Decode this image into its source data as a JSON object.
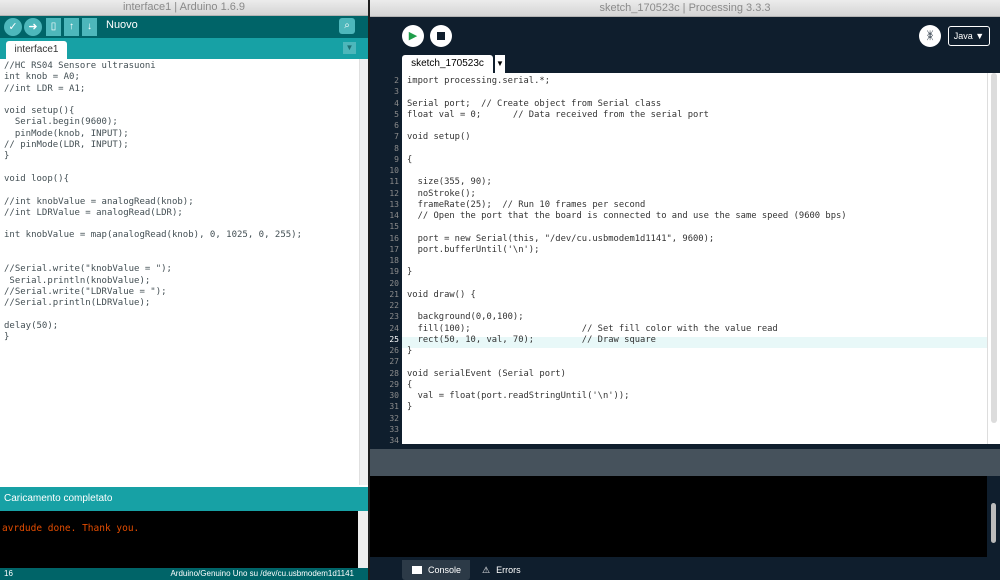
{
  "arduino": {
    "title": "interface1 | Arduino 1.6.9",
    "new_label": "Nuovo",
    "tab_label": "interface1",
    "code_lines": [
      "//HC RS04 Sensore ultrasuoni",
      "int knob = A0;",
      "//int LDR = A1;",
      "",
      "void setup(){",
      "  Serial.begin(9600);",
      "  pinMode(knob, INPUT);",
      "// pinMode(LDR, INPUT);",
      "}",
      "",
      "void loop(){",
      "",
      "//int knobValue = analogRead(knob);",
      "//int LDRValue = analogRead(LDR);",
      "",
      "int knobValue = map(analogRead(knob), 0, 1025, 0, 255);",
      "",
      "",
      "//Serial.write(\"knobValue = \");",
      " Serial.println(knobValue);",
      "//Serial.write(\"LDRValue = \");",
      "//Serial.println(LDRValue);",
      "",
      "delay(50);",
      "}"
    ],
    "status": "Caricamento completato",
    "console_text": "avrdude done.  Thank you.",
    "line_number": "16",
    "board": "Arduino/Genuino Uno su /dev/cu.usbmodem1d1141"
  },
  "processing": {
    "title": "sketch_170523c | Processing 3.3.3",
    "mode_label": "Java ▼",
    "tab_label": "sketch_170523c",
    "lines": [
      {
        "n": "2",
        "t": "import processing.serial.*;"
      },
      {
        "n": "3",
        "t": ""
      },
      {
        "n": "4",
        "t": "Serial port;  // Create object from Serial class"
      },
      {
        "n": "5",
        "t": "float val = 0;      // Data received from the serial port"
      },
      {
        "n": "6",
        "t": ""
      },
      {
        "n": "7",
        "t": "void setup()"
      },
      {
        "n": "8",
        "t": ""
      },
      {
        "n": "9",
        "t": "{"
      },
      {
        "n": "10",
        "t": ""
      },
      {
        "n": "11",
        "t": "  size(355, 90);"
      },
      {
        "n": "12",
        "t": "  noStroke();"
      },
      {
        "n": "13",
        "t": "  frameRate(25);  // Run 10 frames per second"
      },
      {
        "n": "14",
        "t": "  // Open the port that the board is connected to and use the same speed (9600 bps)"
      },
      {
        "n": "15",
        "t": ""
      },
      {
        "n": "16",
        "t": "  port = new Serial(this, \"/dev/cu.usbmodem1d1141\", 9600);"
      },
      {
        "n": "17",
        "t": "  port.bufferUntil('\\n');"
      },
      {
        "n": "18",
        "t": ""
      },
      {
        "n": "19",
        "t": "}"
      },
      {
        "n": "20",
        "t": ""
      },
      {
        "n": "21",
        "t": "void draw() {"
      },
      {
        "n": "22",
        "t": ""
      },
      {
        "n": "23",
        "t": "  background(0,0,100);"
      },
      {
        "n": "24",
        "t": "  fill(100);                     // Set fill color with the value read"
      },
      {
        "n": "25",
        "t": "  rect(50, 10, val, 70);         // Draw square"
      },
      {
        "n": "26",
        "t": "}"
      },
      {
        "n": "27",
        "t": ""
      },
      {
        "n": "28",
        "t": "void serialEvent (Serial port)"
      },
      {
        "n": "29",
        "t": "{"
      },
      {
        "n": "30",
        "t": "  val = float(port.readStringUntil('\\n'));"
      },
      {
        "n": "31",
        "t": "}"
      },
      {
        "n": "32",
        "t": ""
      },
      {
        "n": "33",
        "t": ""
      },
      {
        "n": "34",
        "t": ""
      }
    ],
    "console_tab": "Console",
    "errors_tab": "Errors"
  }
}
